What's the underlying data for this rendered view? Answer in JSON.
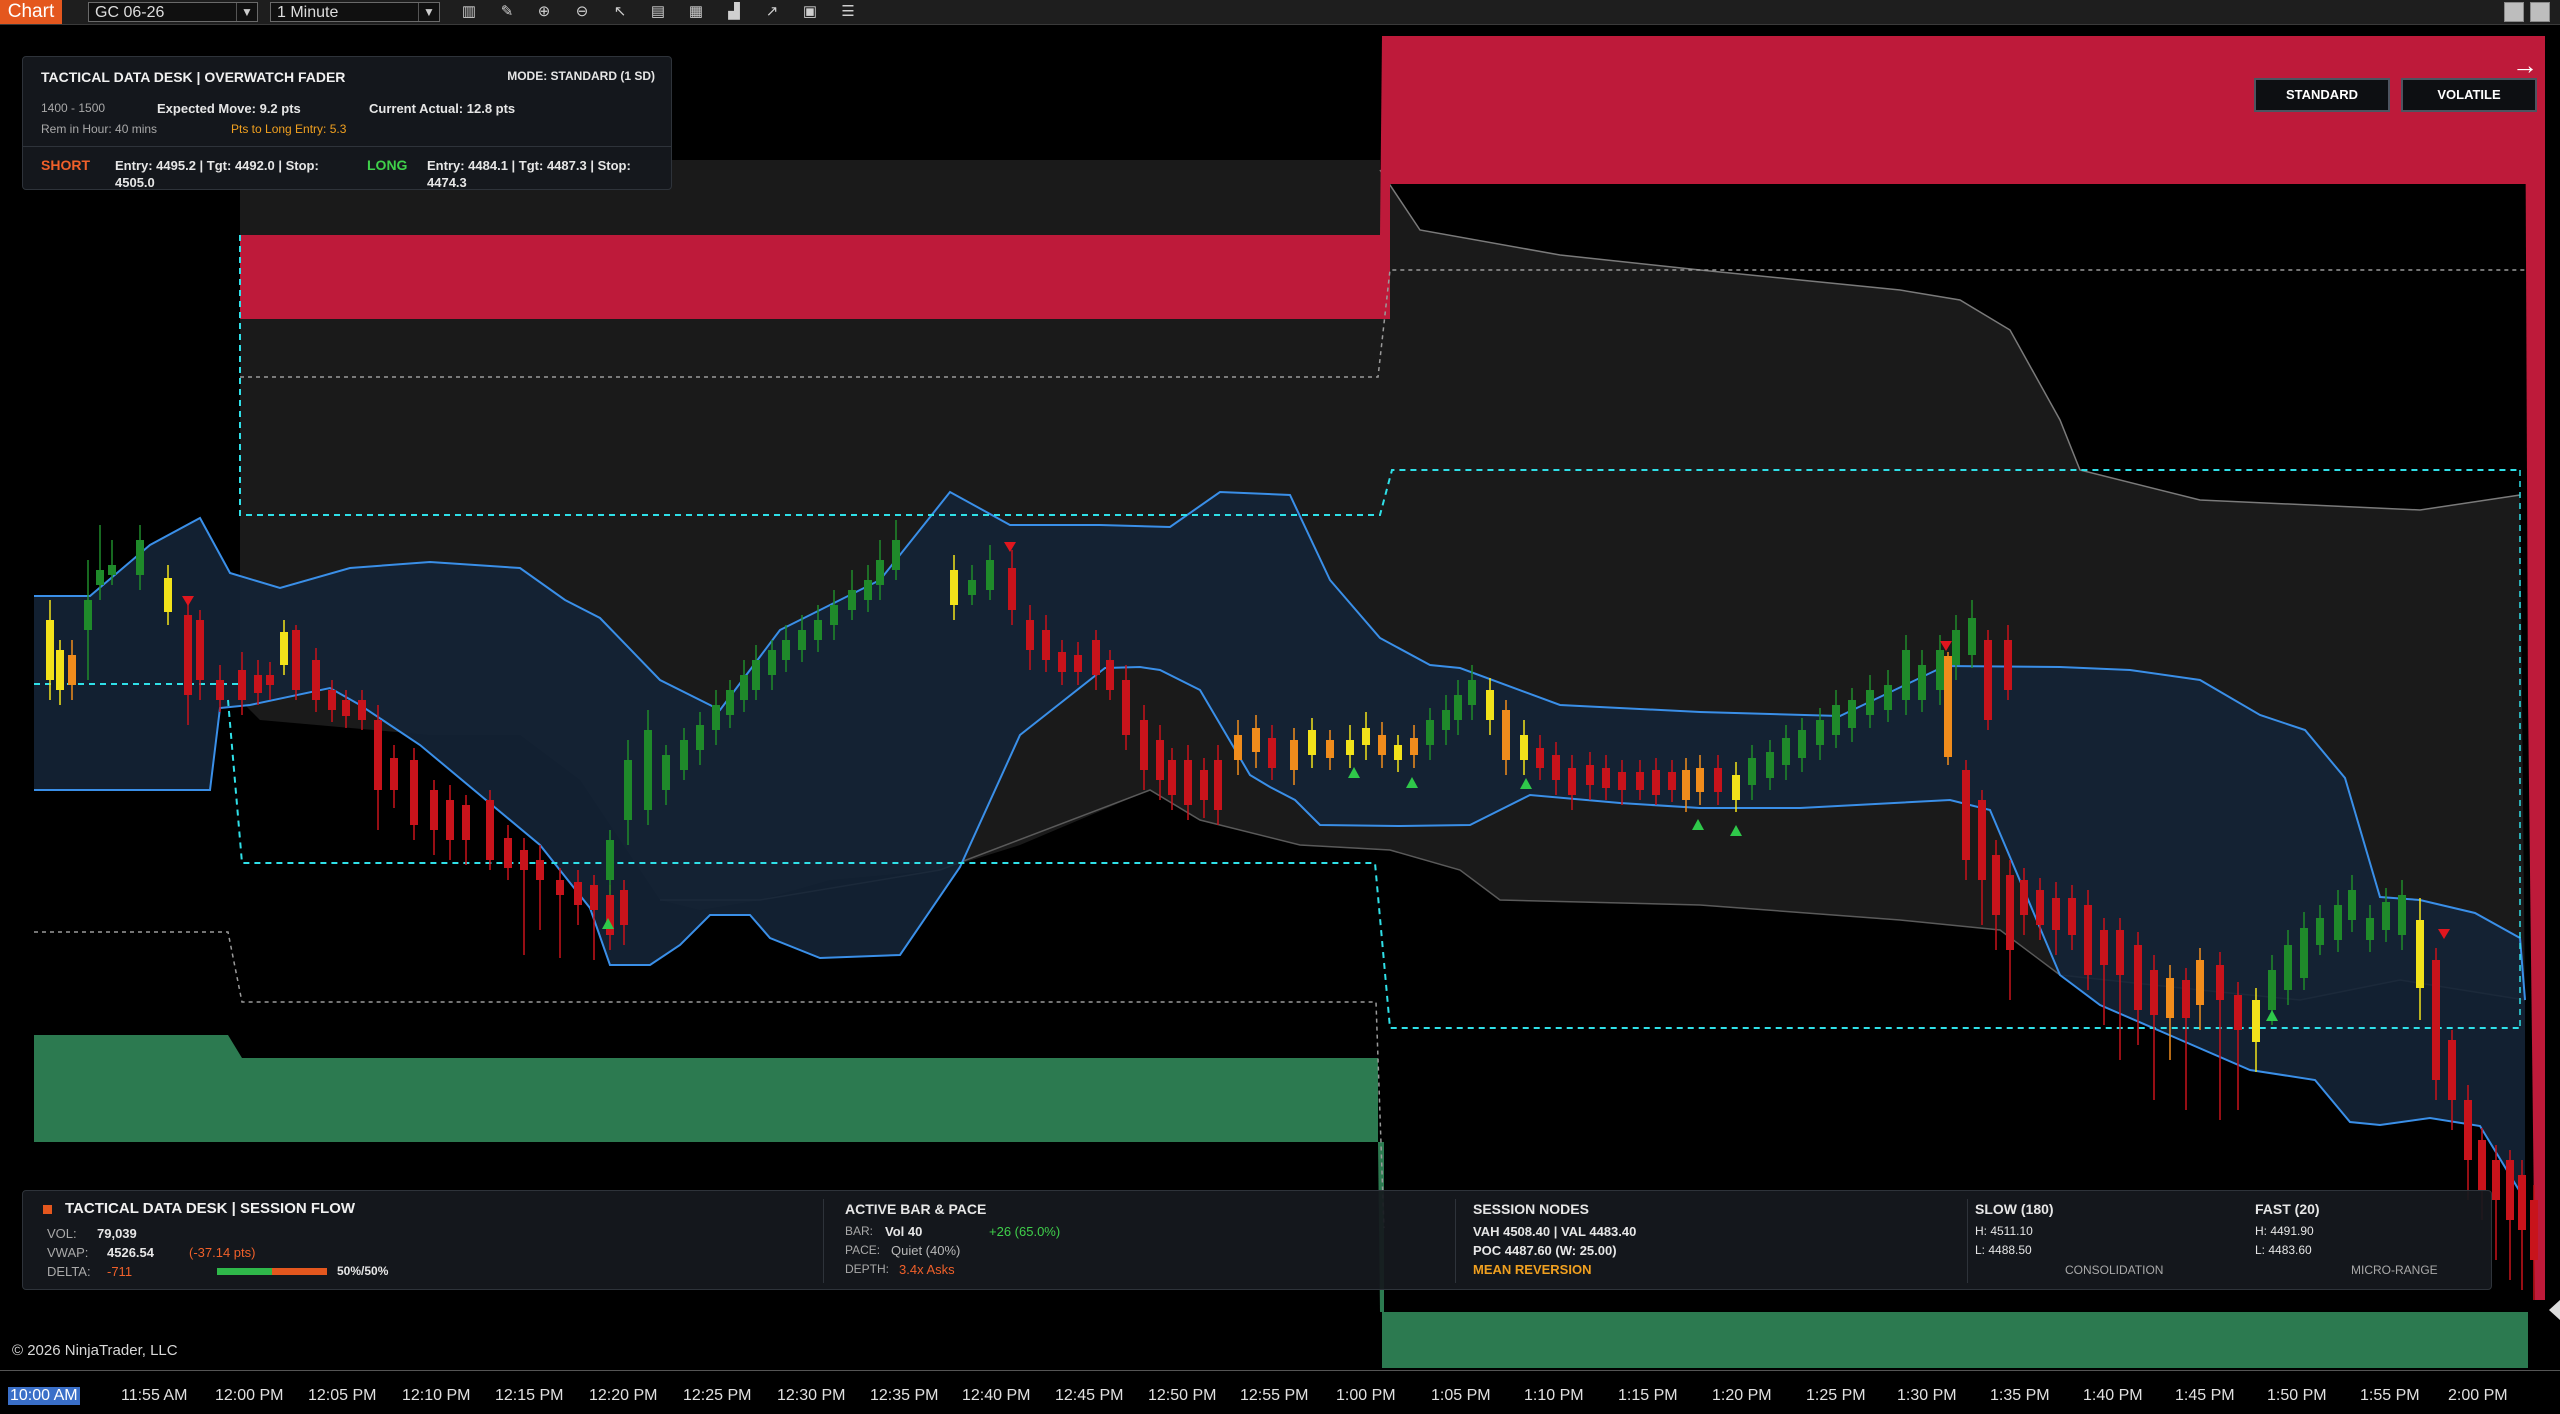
{
  "toolbar": {
    "chart_tab": "Chart",
    "instrument": "GC 06-26",
    "interval": "1 Minute"
  },
  "top_panel": {
    "title": "TACTICAL DATA DESK  |  OVERWATCH FADER",
    "mode": "MODE: STANDARD (1 SD)",
    "hour_range": "1400 - 1500",
    "expected_move": "Expected Move: 9.2 pts",
    "current_actual": "Current Actual: 12.8 pts",
    "rem_in_hour": "Rem in Hour: 40 mins",
    "pts_to_long": "Pts to Long Entry: 5.3",
    "short_label": "SHORT",
    "short_line1": "Entry: 4495.2  |  Tgt: 4492.0  |  Stop:",
    "short_line2": "4505.0",
    "long_label": "LONG",
    "long_line1": "Entry: 4484.1  |  Tgt: 4487.3  |  Stop:",
    "long_line2": "4474.3"
  },
  "mode_buttons": {
    "standard": "STANDARD",
    "volatile": "VOLATILE"
  },
  "bottom_panel": {
    "title": "TACTICAL DATA DESK  |  SESSION FLOW",
    "vol_label": "VOL:",
    "vol_value": "79,039",
    "vwap_label": "VWAP:",
    "vwap_value": "4526.54",
    "vwap_diff": "(-37.14 pts)",
    "delta_label": "DELTA:",
    "delta_value": "-711",
    "delta_ratio": "50%/50%",
    "delta_buy_fraction": 0.5,
    "active_title": "ACTIVE BAR & PACE",
    "bar_label": "BAR:",
    "bar_value": "Vol 40",
    "bar_change": "+26 (65.0%)",
    "pace_label": "PACE:",
    "pace_value": "Quiet (40%)",
    "depth_label": "DEPTH:",
    "depth_value": "3.4x Asks",
    "nodes_title": "SESSION NODES",
    "nodes_line1": "VAH 4508.40  |  VAL 4483.40",
    "nodes_line2": "POC 4487.60  (W: 25.00)",
    "nodes_tag": "MEAN REVERSION",
    "slow_title": "SLOW (180)",
    "slow_high": "H: 4511.10",
    "slow_low": "L: 4488.50",
    "slow_tag": "CONSOLIDATION",
    "fast_title": "FAST (20)",
    "fast_high": "H: 4491.90",
    "fast_low": "L: 4483.60",
    "fast_tag": "MICRO-RANGE"
  },
  "copyright": "© 2026 NinjaTrader, LLC",
  "x_axis": {
    "labels": [
      "10:00 AM",
      "11:55 AM",
      "12:00 PM",
      "12:05 PM",
      "12:10 PM",
      "12:15 PM",
      "12:20 PM",
      "12:25 PM",
      "12:30 PM",
      "12:35 PM",
      "12:40 PM",
      "12:45 PM",
      "12:50 PM",
      "12:55 PM",
      "1:00 PM",
      "1:05 PM",
      "1:10 PM",
      "1:15 PM",
      "1:20 PM",
      "1:25 PM",
      "1:30 PM",
      "1:35 PM",
      "1:40 PM",
      "1:45 PM",
      "1:50 PM",
      "1:55 PM",
      "2:00 PM"
    ]
  },
  "colors": {
    "background": "#000000",
    "accent_orange": "#e4571e",
    "red_zone": "#be1a3a",
    "green_zone": "#2c7a50",
    "band_fill": "#142436",
    "band_line": "#3a8fe8",
    "cyan_dash": "#2fe0e8",
    "up_candle": "#1f8a2a",
    "down_candle": "#c8131b",
    "yellow_candle": "#f2e21a",
    "orange_candle": "#f08c1c",
    "short_color": "#f0602a",
    "long_color": "#3fd04a",
    "warn_color": "#f0a020"
  },
  "icons": [
    "bar-style-icon",
    "draw-icon",
    "zoom-in-icon",
    "zoom-out-icon",
    "pointer-icon",
    "data-box-icon",
    "templates-icon",
    "indicators-icon",
    "strategies-icon",
    "properties-icon",
    "list-icon"
  ]
}
